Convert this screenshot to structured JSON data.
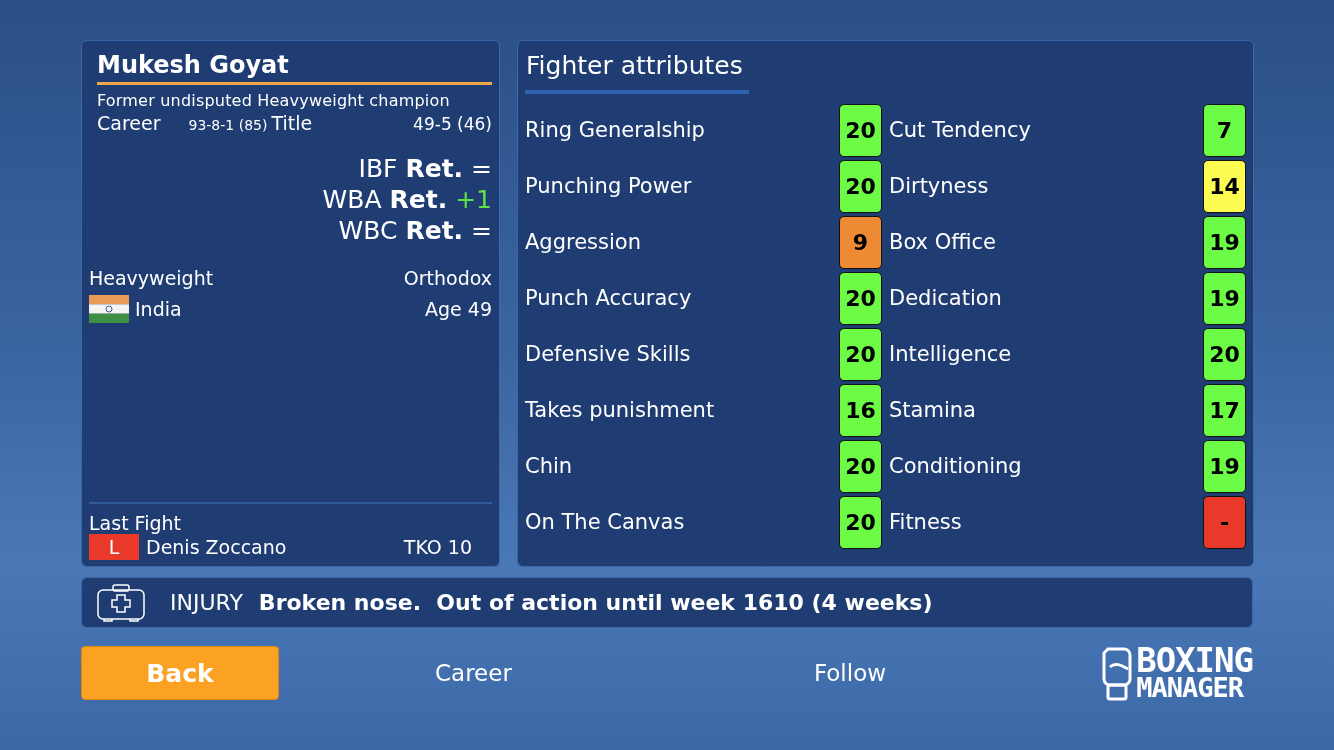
{
  "fighter": {
    "name": "Mukesh Goyat",
    "subtitle": "Former undisputed Heavyweight champion",
    "records": [
      {
        "label": "Career",
        "value": "93-8-1 (85)"
      },
      {
        "label": "Title",
        "value": "49-5 (46)"
      }
    ],
    "belts": [
      {
        "body": "IBF",
        "rank": "Ret.",
        "change": "=",
        "color": "#ffffff"
      },
      {
        "body": "WBA",
        "rank": "Ret.",
        "change": "+1",
        "color": "#5fe048"
      },
      {
        "body": "WBC",
        "rank": "Ret.",
        "change": "=",
        "color": "#ffffff"
      }
    ],
    "division": "Heavyweight",
    "stance": "Orthodox",
    "country": "India",
    "age": "Age 49",
    "last_fight": {
      "heading": "Last Fight",
      "result": "L",
      "opponent": "Denis Zoccano",
      "method": "TKO 10"
    }
  },
  "attributes": {
    "title": "Fighter attributes",
    "items": [
      {
        "name": "Ring Generalship",
        "value": "20",
        "color": "#6dfc46"
      },
      {
        "name": "Cut Tendency",
        "value": "7",
        "color": "#6dfc46"
      },
      {
        "name": "Punching Power",
        "value": "20",
        "color": "#6dfc46"
      },
      {
        "name": "Dirtyness",
        "value": "14",
        "color": "#fdfc52"
      },
      {
        "name": "Aggression",
        "value": "9",
        "color": "#ee8a33"
      },
      {
        "name": "Box Office",
        "value": "19",
        "color": "#6dfc46"
      },
      {
        "name": "Punch Accuracy",
        "value": "20",
        "color": "#6dfc46"
      },
      {
        "name": "Dedication",
        "value": "19",
        "color": "#6dfc46"
      },
      {
        "name": "Defensive Skills",
        "value": "20",
        "color": "#6dfc46"
      },
      {
        "name": "Intelligence",
        "value": "20",
        "color": "#6dfc46"
      },
      {
        "name": "Takes punishment",
        "value": "16",
        "color": "#6dfc46"
      },
      {
        "name": "Stamina",
        "value": "17",
        "color": "#6dfc46"
      },
      {
        "name": "Chin",
        "value": "20",
        "color": "#6dfc46"
      },
      {
        "name": "Conditioning",
        "value": "19",
        "color": "#6dfc46"
      },
      {
        "name": "On The Canvas",
        "value": "20",
        "color": "#6dfc46"
      },
      {
        "name": "Fitness",
        "value": "-",
        "color": "#e8392a"
      }
    ]
  },
  "injury": {
    "label": "INJURY",
    "text": "Broken nose.  Out of action until week 1610 (4 weeks)"
  },
  "nav": [
    {
      "label": "Back",
      "kind": "primary"
    },
    {
      "label": "Career",
      "kind": "link"
    },
    {
      "label": "Follow",
      "kind": "link"
    }
  ],
  "logo": {
    "line1": "BOXING",
    "line2": "MANAGER"
  }
}
